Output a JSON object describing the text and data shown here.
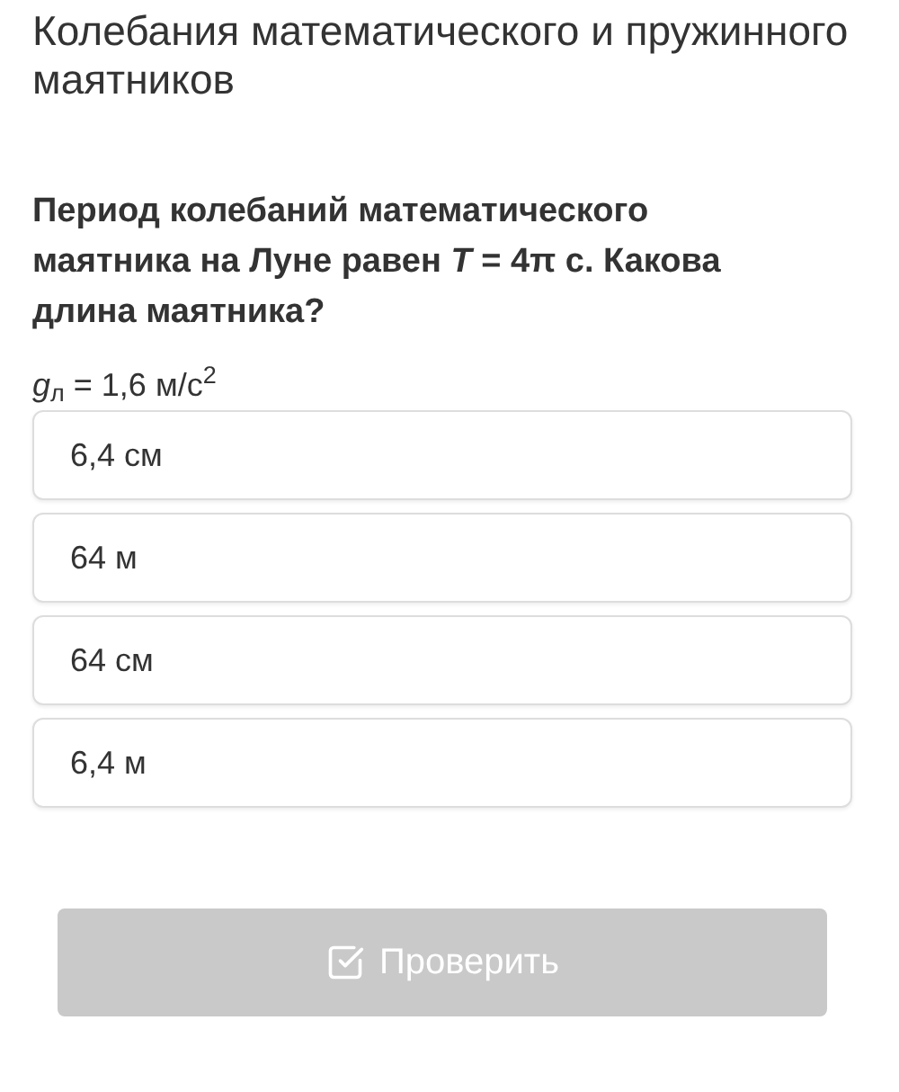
{
  "title": "Колебания математического и пружинного маятников",
  "question": "Период колебаний математического маятника на Луне равен *T* = 4π с. Какова длина маятника?",
  "formula": "*g*$_{л}$ = 1,6 м/с$^{2}$",
  "options": [
    {
      "label": "6,4 см",
      "selected": false
    },
    {
      "label": "64 м",
      "selected": false
    },
    {
      "label": "64 см",
      "selected": false
    },
    {
      "label": "6,4 м",
      "selected": false
    }
  ],
  "check_button": {
    "label": "Проверить",
    "disabled": true
  }
}
